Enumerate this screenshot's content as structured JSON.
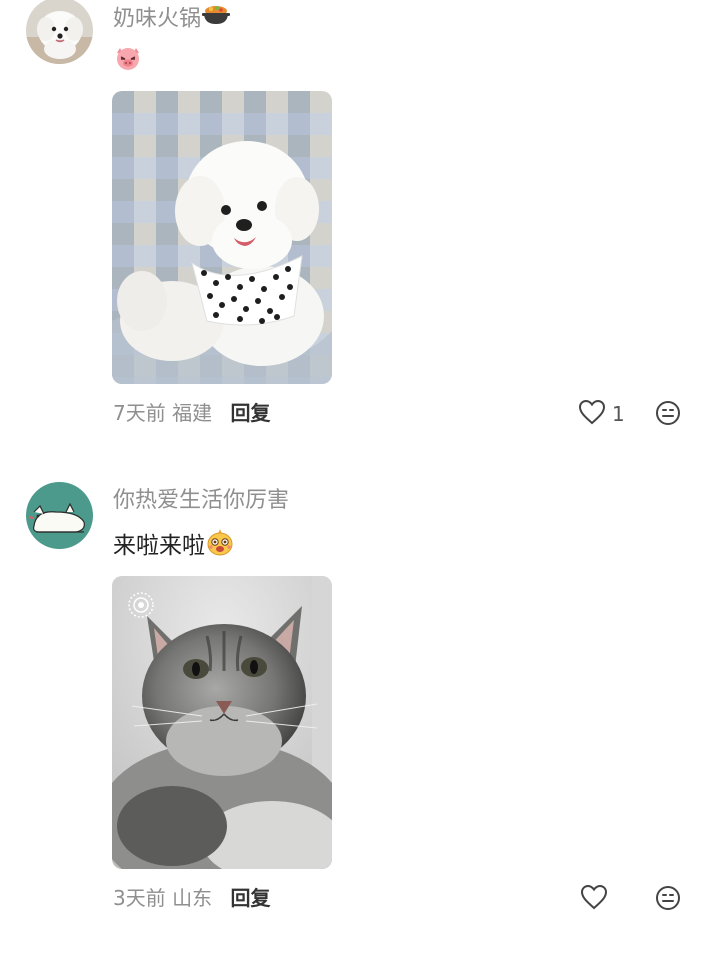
{
  "comments": [
    {
      "username": "奶味火锅",
      "username_emoji": "hotpot-emoji",
      "text": "",
      "text_emoji": "pig-face-emoji",
      "photo": "white-bichon-dog-photo",
      "time": "7天前",
      "location": "福建",
      "reply_label": "回复",
      "like_count": "1",
      "like_icon": "heart-outline-icon",
      "more_icon": "face-menu-icon"
    },
    {
      "username": "你热爱生活你厉害",
      "username_emoji": "",
      "text": "来啦来啦",
      "text_emoji": "excited-face-emoji",
      "photo": "gray-tabby-cat-photo",
      "time": "3天前",
      "location": "山东",
      "reply_label": "回复",
      "like_count": "",
      "like_icon": "heart-outline-icon",
      "more_icon": "face-menu-icon"
    }
  ],
  "colors": {
    "meta_text": "#8f8f8f",
    "body_text": "#222222",
    "reply": "#333333",
    "icon_stroke": "#444444"
  }
}
